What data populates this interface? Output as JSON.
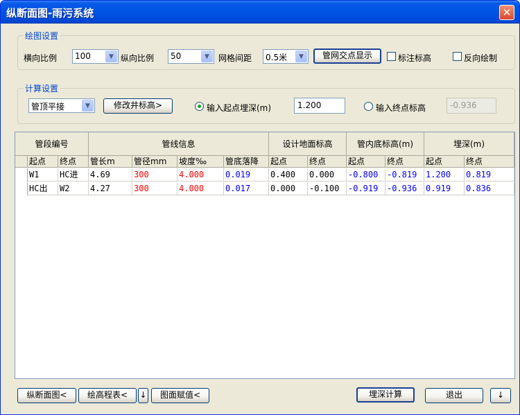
{
  "window": {
    "title": "纵断面图-雨污系统",
    "close_label": "✕"
  },
  "draw_settings": {
    "group_title": "绘图设置",
    "h_scale_label": "横向比例",
    "h_scale_value": "100",
    "v_scale_label": "纵向比例",
    "v_scale_value": "50",
    "grid_label": "网格间距",
    "grid_value": "0.5米",
    "intersection_button": "管网交点显示",
    "mark_elevation_label": "标注标高",
    "mark_elevation_checked": false,
    "reverse_draw_label": "反向绘制",
    "reverse_draw_checked": false
  },
  "calc_settings": {
    "group_title": "计算设置",
    "mode_value": "管顶平接",
    "modify_button": "修改井标高>",
    "start_radio_label": "输入起点埋深(m)",
    "start_radio_selected": true,
    "start_value": "1.200",
    "end_radio_label": "输入终点标高",
    "end_radio_selected": false,
    "end_value": "-0.936"
  },
  "table": {
    "group_headers": [
      "管段编号",
      "管线信息",
      "设计地面标高",
      "管内底标高(m)",
      "埋深(m)"
    ],
    "sub_headers": [
      "起点",
      "终点",
      "管长m",
      "管径mm",
      "坡度‰",
      "管底落降",
      "起点",
      "终点",
      "起点",
      "终点",
      "起点",
      "终点"
    ],
    "rows": [
      [
        "W1",
        "HC进",
        "4.69",
        "300",
        "4.000",
        "0.019",
        "0.400",
        "0.000",
        "-0.800",
        "-0.819",
        "1.200",
        "0.819"
      ],
      [
        "HC出",
        "W2",
        "4.27",
        "300",
        "4.000",
        "0.017",
        "0.000",
        "-0.100",
        "-0.919",
        "-0.936",
        "0.919",
        "0.836"
      ]
    ],
    "colors": {
      "red": "#ff0000",
      "blue": "#0000ff"
    }
  },
  "bottom": {
    "profile_button": "纵断面图<",
    "elevation_table_button": "绘高程表<",
    "down_arrow_1": "↓",
    "plan_value_button": "图面赋值<",
    "depth_calc_button": "埋深计算",
    "exit_button": "退出",
    "down_arrow_2": "↓"
  }
}
